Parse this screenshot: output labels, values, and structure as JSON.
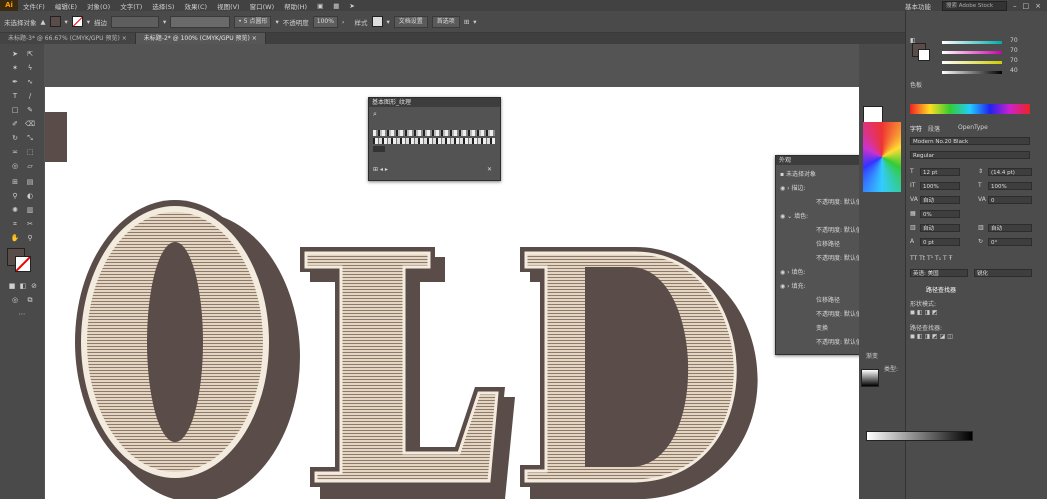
{
  "menubar": {
    "logo": "Ai",
    "items": [
      "文件(F)",
      "编辑(E)",
      "对象(O)",
      "文字(T)",
      "选择(S)",
      "效果(C)",
      "视图(V)",
      "窗口(W)",
      "帮助(H)"
    ],
    "workspace": "基本功能",
    "search_placeholder": "搜索 Adobe Stock"
  },
  "controlbar": {
    "selection_label": "未选择对象",
    "stroke_label": "描边",
    "brush_value": "5 点圆形",
    "opacity_label": "不透明度",
    "opacity_value": "100%",
    "style_label": "样式",
    "doc_setup": "文档设置",
    "preferences": "首选项"
  },
  "tabs": [
    {
      "label": "未标题-3* @ 66.67% (CMYK/GPU 预览)",
      "close": "×"
    },
    {
      "label": "未标题-2* @ 100% (CMYK/GPU 预览)",
      "close": "×"
    }
  ],
  "swatch_panel": {
    "title": "基本图形_纹理",
    "search_icon": "⌕"
  },
  "appearance_panel": {
    "title": "外观",
    "rows": [
      "未选择对象",
      "描边:",
      "不透明度: 默认值",
      "填色:",
      "不透明度: 默认值",
      "位移路径",
      "不透明度: 默认值",
      "填色:",
      "填充:",
      "位移路径",
      "不透明度: 默认值",
      "变换",
      "不透明度: 默认值",
      "不透明度: 默认值"
    ],
    "fx": "fx"
  },
  "right_dock": {
    "color": {
      "values": [
        "70",
        "70",
        "70",
        "40"
      ],
      "title": "色板"
    },
    "character_tabs": [
      "字符",
      "段落",
      "OpenType"
    ],
    "font_family": "Modern No.20 Black",
    "font_style": "Regular",
    "size": "12 pt",
    "leading": "(14.4 pt)",
    "scale_h": "100%",
    "scale_v": "100%",
    "tracking": "自动",
    "kerning": "0",
    "baseline": "0%",
    "shift": "0 pt",
    "rotate": "0°",
    "auto1": "自动",
    "auto2": "自动",
    "lang": "英语: 美国",
    "aa": "锐化",
    "pathfinder_title": "路径查找器",
    "shape_modes": "形状模式:",
    "pathfinders": "路径查找器:",
    "gradient_title": "渐变",
    "gradient_type": "类型:"
  },
  "artwork": {
    "text": "OLD",
    "colors": {
      "fill": "#e6d5be",
      "shadow": "#5a4c48",
      "stripe": "#8a7a72"
    }
  }
}
